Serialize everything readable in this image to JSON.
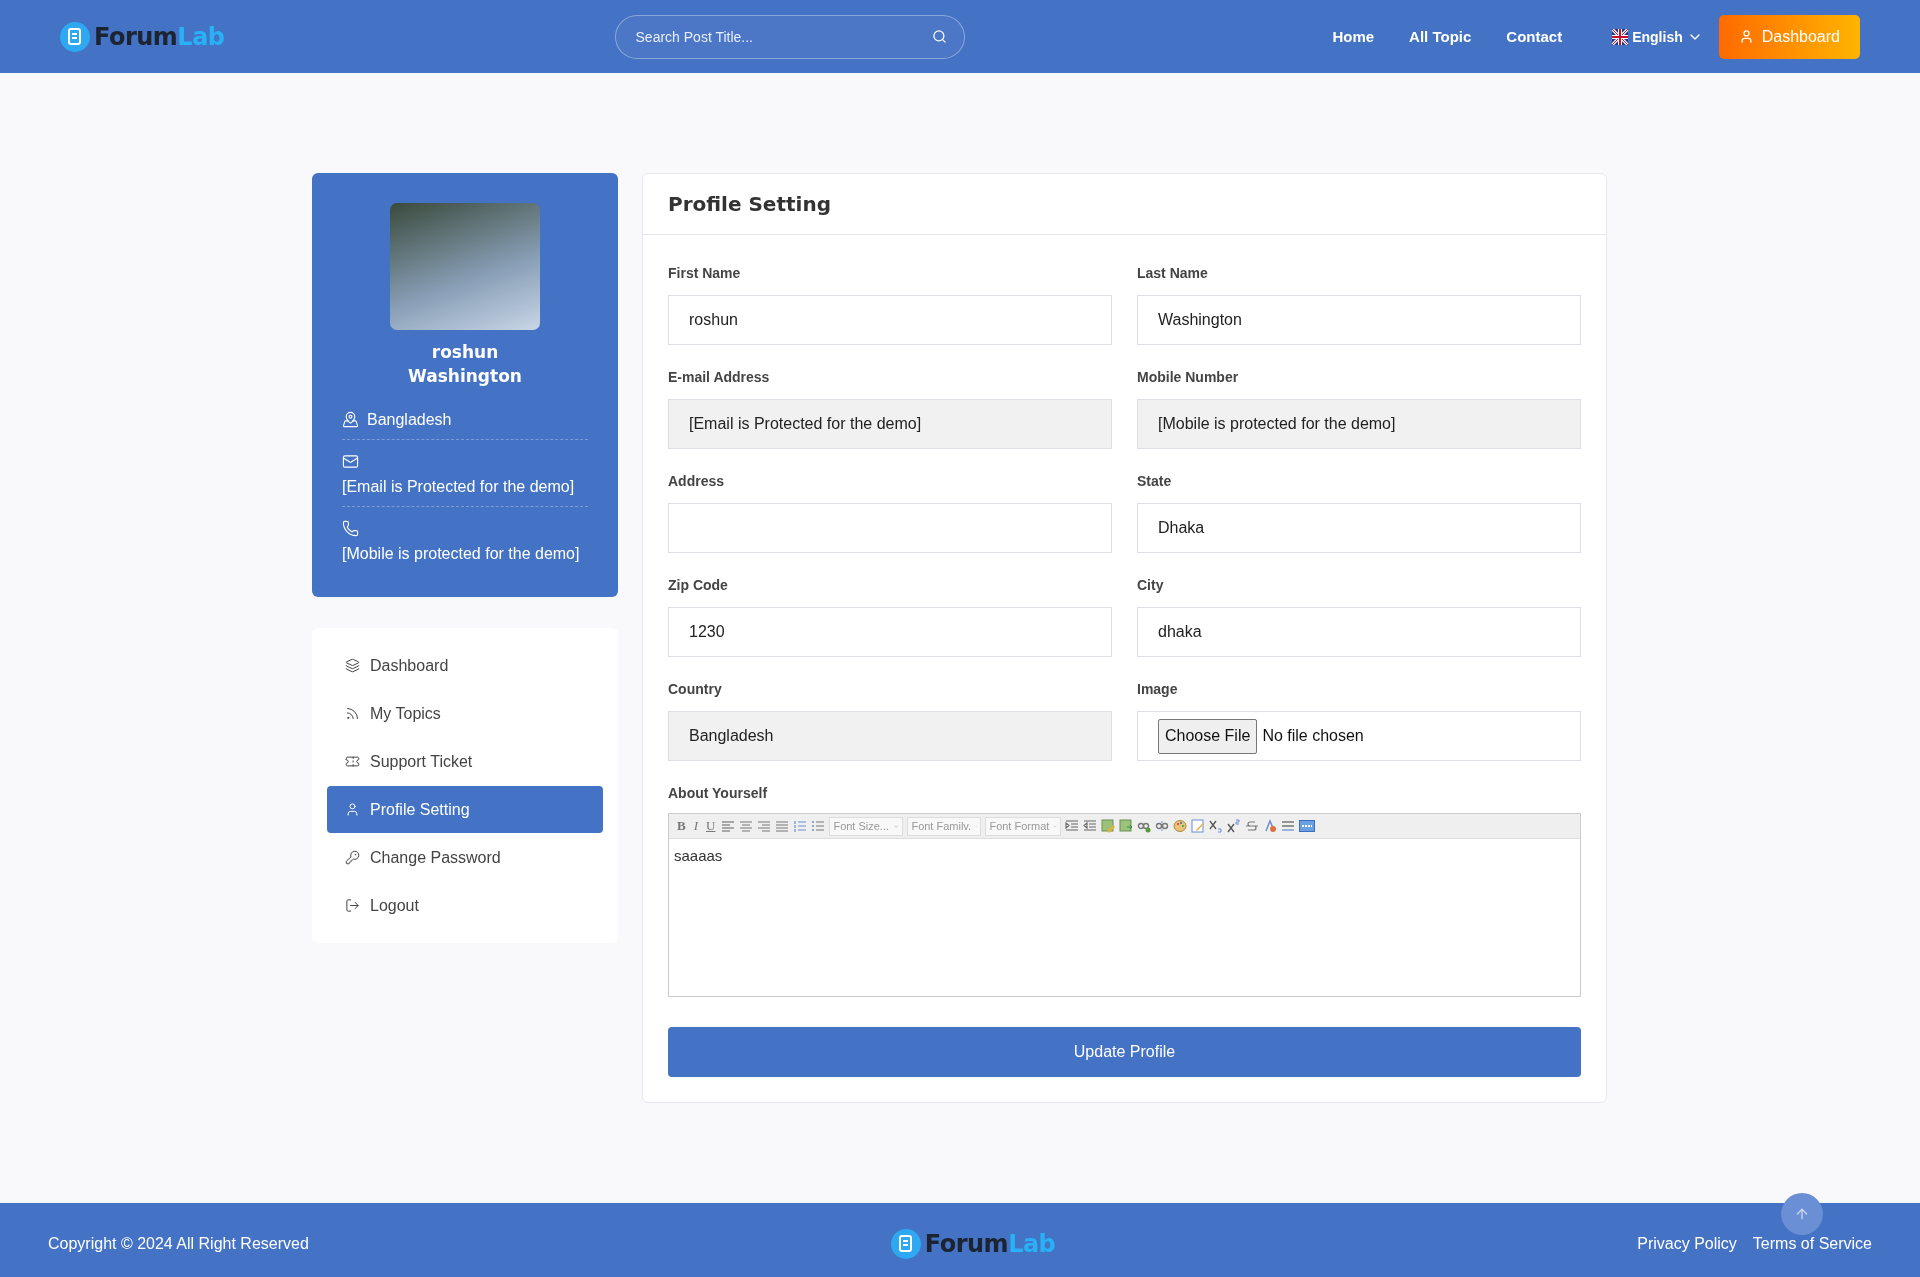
{
  "header": {
    "logo": {
      "first": "Forum",
      "second": "Lab"
    },
    "search": {
      "placeholder": "Search Post Title..."
    },
    "nav": [
      "Home",
      "All Topic",
      "Contact"
    ],
    "language": "English",
    "dashboard_button": "Dashboard"
  },
  "profile": {
    "first_name": "roshun",
    "last_name": "Washington",
    "info": [
      {
        "text": "Bangladesh",
        "inline": true
      },
      {
        "text": "[Email is Protected for the demo]",
        "inline": false
      },
      {
        "text": "[Mobile is protected for the demo]",
        "inline": false
      }
    ]
  },
  "menu": [
    {
      "label": "Dashboard",
      "selected": false
    },
    {
      "label": "My Topics",
      "selected": false
    },
    {
      "label": "Support Ticket",
      "selected": false
    },
    {
      "label": "Profile Setting",
      "selected": true
    },
    {
      "label": "Change Password",
      "selected": false
    },
    {
      "label": "Logout",
      "selected": false
    }
  ],
  "form": {
    "title": "Profile Setting",
    "fields": [
      {
        "label": "First Name",
        "kind": "text",
        "value": "roshun"
      },
      {
        "label": "Last Name",
        "kind": "text",
        "value": "Washington"
      },
      {
        "label": "E-mail Address",
        "kind": "readonly",
        "value": "[Email is Protected for the demo]"
      },
      {
        "label": "Mobile Number",
        "kind": "readonly",
        "value": "[Mobile is protected for the demo]"
      },
      {
        "label": "Address",
        "kind": "text"
      },
      {
        "label": "State",
        "kind": "text",
        "value": "Dhaka"
      },
      {
        "label": "Zip Code",
        "kind": "text",
        "value": "1230"
      },
      {
        "label": "City",
        "kind": "text",
        "value": "dhaka"
      },
      {
        "label": "Country",
        "kind": "readonly",
        "value": "Bangladesh"
      },
      {
        "label": "Image",
        "kind": "file",
        "button": "Choose File",
        "status": "No file chosen"
      }
    ],
    "about": {
      "label": "About Yourself",
      "letters": [
        "B",
        "I",
        "U"
      ],
      "dropdowns": [
        "Font Size...",
        "Font Familv.",
        "Font Format"
      ],
      "value": "saaaas"
    },
    "submit": "Update Profile"
  },
  "footer": {
    "copyright": "Copyright © 2024 All Right Reserved",
    "logo": {
      "first": "Forum",
      "second": "Lab"
    },
    "links": [
      "Privacy Policy",
      "Terms of Service"
    ]
  }
}
